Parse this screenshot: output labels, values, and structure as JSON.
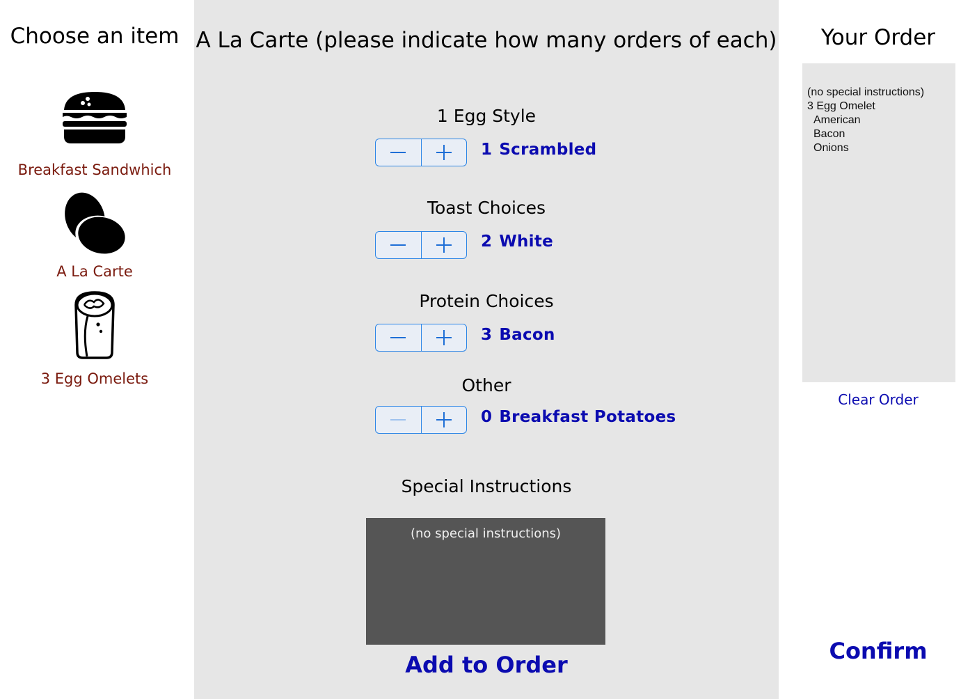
{
  "left": {
    "title": "Choose an item",
    "items": [
      {
        "label": "Breakfast Sandwhich",
        "icon": "sandwich-icon"
      },
      {
        "label": "A La Carte",
        "icon": "eggs-icon"
      },
      {
        "label": "3 Egg Omelets",
        "icon": "burrito-icon"
      }
    ]
  },
  "center": {
    "title": "A La Carte (please indicate how many orders of each)",
    "sections": [
      {
        "title": "1 Egg Style",
        "count": "1",
        "item": "Scrambled"
      },
      {
        "title": "Toast Choices",
        "count": "2",
        "item": "White"
      },
      {
        "title": "Protein Choices",
        "count": "3",
        "item": "Bacon"
      },
      {
        "title": "Other",
        "count": "0",
        "item": "Breakfast Potatoes"
      }
    ],
    "stepper": {
      "minus": "−",
      "plus": "+"
    },
    "special_title": "Special Instructions",
    "special_placeholder": "(no special instructions)",
    "add_label": "Add to Order"
  },
  "right": {
    "title": "Your Order",
    "order_lines": [
      "(no special instructions)",
      "3 Egg Omelet"
    ],
    "order_sub_lines": [
      "American",
      "Bacon",
      "Onions"
    ],
    "clear_label": "Clear Order",
    "confirm_label": "Confirm"
  },
  "colors": {
    "link": "#0b0bb0",
    "menu_label": "#7a1a0e",
    "panel": "#e6e6e6",
    "stepper_border": "#2d86e6",
    "special_box": "#555555"
  }
}
